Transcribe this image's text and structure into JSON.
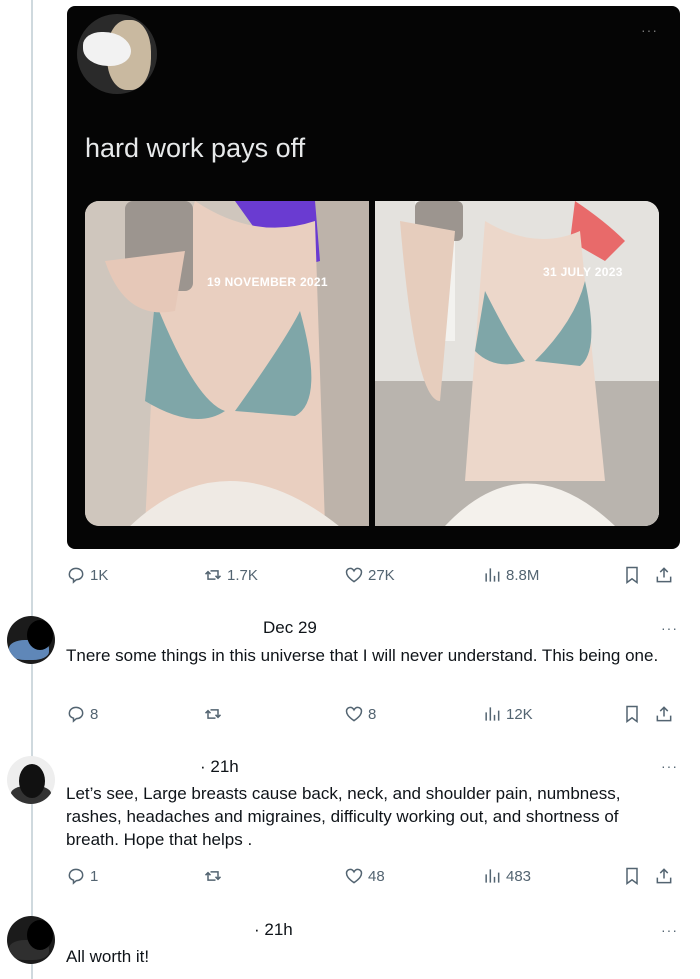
{
  "post": {
    "text": "hard work pays off",
    "photos": [
      {
        "date": "19 NOVEMBER 2021"
      },
      {
        "date": "31 JULY 2023"
      }
    ],
    "stats": {
      "replies": "1K",
      "reposts": "1.7K",
      "likes": "27K",
      "views": "8.8M"
    }
  },
  "replies": [
    {
      "time": "Dec 29",
      "text": "Tnere some things in this universe that I will never understand. This being one.",
      "stats": {
        "replies": "8",
        "reposts": "",
        "likes": "8",
        "views": "12K"
      }
    },
    {
      "time": "· 21h",
      "text": "Let’s see, Large breasts cause back, neck, and shoulder pain, numbness, rashes, headaches and migraines, difficulty working out, and shortness of breath. Hope that helps .",
      "stats": {
        "replies": "1",
        "reposts": "",
        "likes": "48",
        "views": "483"
      }
    },
    {
      "time": "· 21h",
      "text": "All worth it!"
    }
  ],
  "more_glyph": "···",
  "icons": [
    "reply-icon",
    "repost-icon",
    "like-icon",
    "views-icon",
    "bookmark-icon",
    "share-icon"
  ]
}
